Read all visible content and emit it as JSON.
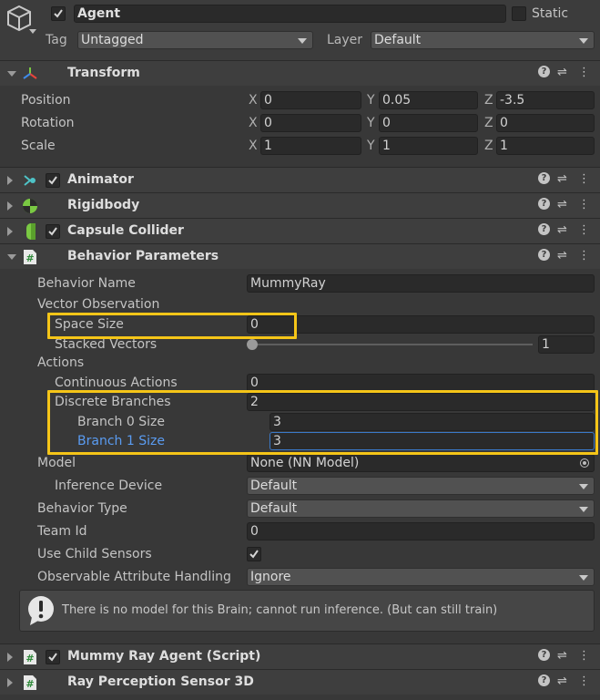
{
  "object": {
    "active": true,
    "name": "Agent",
    "static_label": "Static",
    "tag_label": "Tag",
    "tag_value": "Untagged",
    "layer_label": "Layer",
    "layer_value": "Default"
  },
  "transform": {
    "title": "Transform",
    "rows": [
      {
        "label": "Position",
        "x": "0",
        "y": "0.05",
        "z": "-3.5"
      },
      {
        "label": "Rotation",
        "x": "0",
        "y": "0",
        "z": "0"
      },
      {
        "label": "Scale",
        "x": "1",
        "y": "1",
        "z": "1"
      }
    ],
    "axis_x": "X",
    "axis_y": "Y",
    "axis_z": "Z"
  },
  "components": {
    "animator": "Animator",
    "rigidbody": "Rigidbody",
    "capsule": "Capsule Collider",
    "behavior": "Behavior Parameters",
    "agent_script": "Mummy Ray Agent (Script)",
    "ray_sensor": "Ray Perception Sensor 3D"
  },
  "behavior": {
    "behavior_name_label": "Behavior Name",
    "behavior_name_value": "MummyRay",
    "vector_obs_label": "Vector Observation",
    "space_size_label": "Space Size",
    "space_size_value": "0",
    "stacked_label": "Stacked Vectors",
    "stacked_value": "1",
    "stacked_fraction": 0,
    "actions_label": "Actions",
    "continuous_label": "Continuous Actions",
    "continuous_value": "0",
    "discrete_label": "Discrete Branches",
    "discrete_value": "2",
    "branch0_label": "Branch 0 Size",
    "branch0_value": "3",
    "branch1_label": "Branch 1 Size",
    "branch1_value": "3",
    "model_label": "Model",
    "model_value": "None (NN Model)",
    "inference_label": "Inference Device",
    "inference_value": "Default",
    "behavior_type_label": "Behavior Type",
    "behavior_type_value": "Default",
    "team_label": "Team Id",
    "team_value": "0",
    "child_sensors_label": "Use Child Sensors",
    "child_sensors_checked": true,
    "observable_label": "Observable Attribute Handling",
    "observable_value": "Ignore",
    "warning_text": "There is no model for this Brain; cannot run inference. (But can still train)"
  },
  "help_glyph": "?",
  "colors": {
    "highlight": "#f5c518",
    "focused_label": "#5a9cf2",
    "background": "#383838"
  }
}
